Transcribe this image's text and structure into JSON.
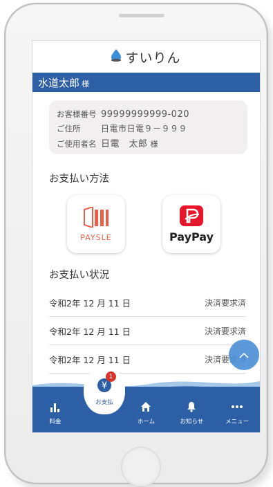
{
  "app": {
    "logo_text": "すいりん"
  },
  "user": {
    "name": "水道太郎",
    "honorific": "様"
  },
  "info": {
    "rows": [
      {
        "label": "お客様番号",
        "value": "99999999999-020"
      },
      {
        "label": "ご住所",
        "value": "日電市日電９－９９９"
      },
      {
        "label": "ご使用者名",
        "value": "日電　太郎",
        "suffix": "様"
      }
    ]
  },
  "payment": {
    "title": "お支払い方法",
    "methods": [
      {
        "name": "PAYSLE",
        "icon": "paysle-logo"
      },
      {
        "name": "PayPay",
        "icon": "paypay-logo"
      }
    ]
  },
  "status": {
    "title": "お支払い状況",
    "rows": [
      {
        "date": "令和2年 12 月 11 日",
        "state": "決済要求済"
      },
      {
        "date": "令和2年 12 月 11 日",
        "state": "決済要求済"
      },
      {
        "date": "令和2年 12 月 11 日",
        "state": "決済要求済"
      }
    ]
  },
  "nav": {
    "items": [
      {
        "label": "料金",
        "icon": "bar-chart-icon"
      },
      {
        "label": "お支払",
        "icon": "yen-coin-icon",
        "badge": "1",
        "active": true
      },
      {
        "label": "ホーム",
        "icon": "home-icon"
      },
      {
        "label": "お知らせ",
        "icon": "bell-icon"
      },
      {
        "label": "メニュー",
        "icon": "more-dots-icon"
      }
    ]
  },
  "colors": {
    "primary": "#2d5fa6",
    "paysle": "#e9604a",
    "paypay": "#e6172a",
    "badge": "#d9342b",
    "fab": "#4a8fd8"
  }
}
